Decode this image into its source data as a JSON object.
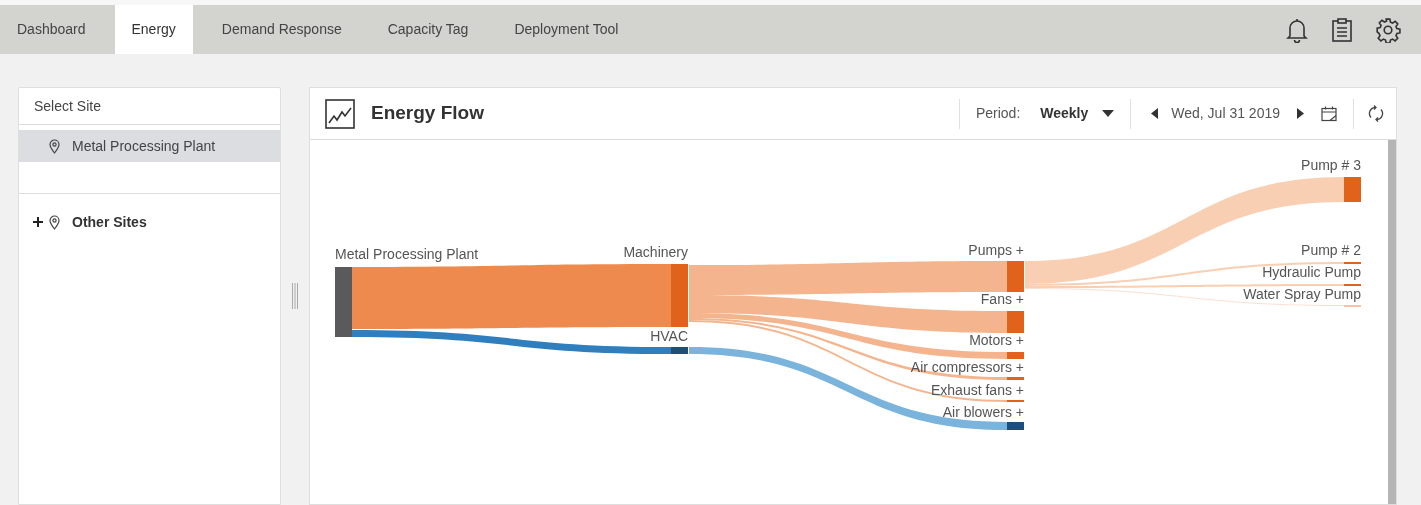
{
  "tabs": [
    {
      "label": "Dashboard",
      "selected": false
    },
    {
      "label": "Energy",
      "selected": true
    },
    {
      "label": "Demand Response",
      "selected": false
    },
    {
      "label": "Capacity Tag",
      "selected": false
    },
    {
      "label": "Deployment Tool",
      "selected": false
    }
  ],
  "sidebar": {
    "title": "Select Site",
    "sites": [
      {
        "label": "Metal Processing Plant",
        "selected": true
      }
    ],
    "other_sites": {
      "label": "Other Sites",
      "expanded": false
    }
  },
  "panel": {
    "title": "Energy Flow",
    "period_label": "Period:",
    "period_value": "Weekly",
    "date": "Wed, Jul 31 2019",
    "flow_nodes": [
      "Metal Processing Plant",
      "Machinery",
      "HVAC",
      "Pumps +",
      "Fans +",
      "Motors +",
      "Air compressors +",
      "Exhaust fans +",
      "Air blowers +",
      "Pump # 3",
      "Pump # 2",
      "Hydraulic Pump",
      "Water Spray Pump"
    ]
  }
}
